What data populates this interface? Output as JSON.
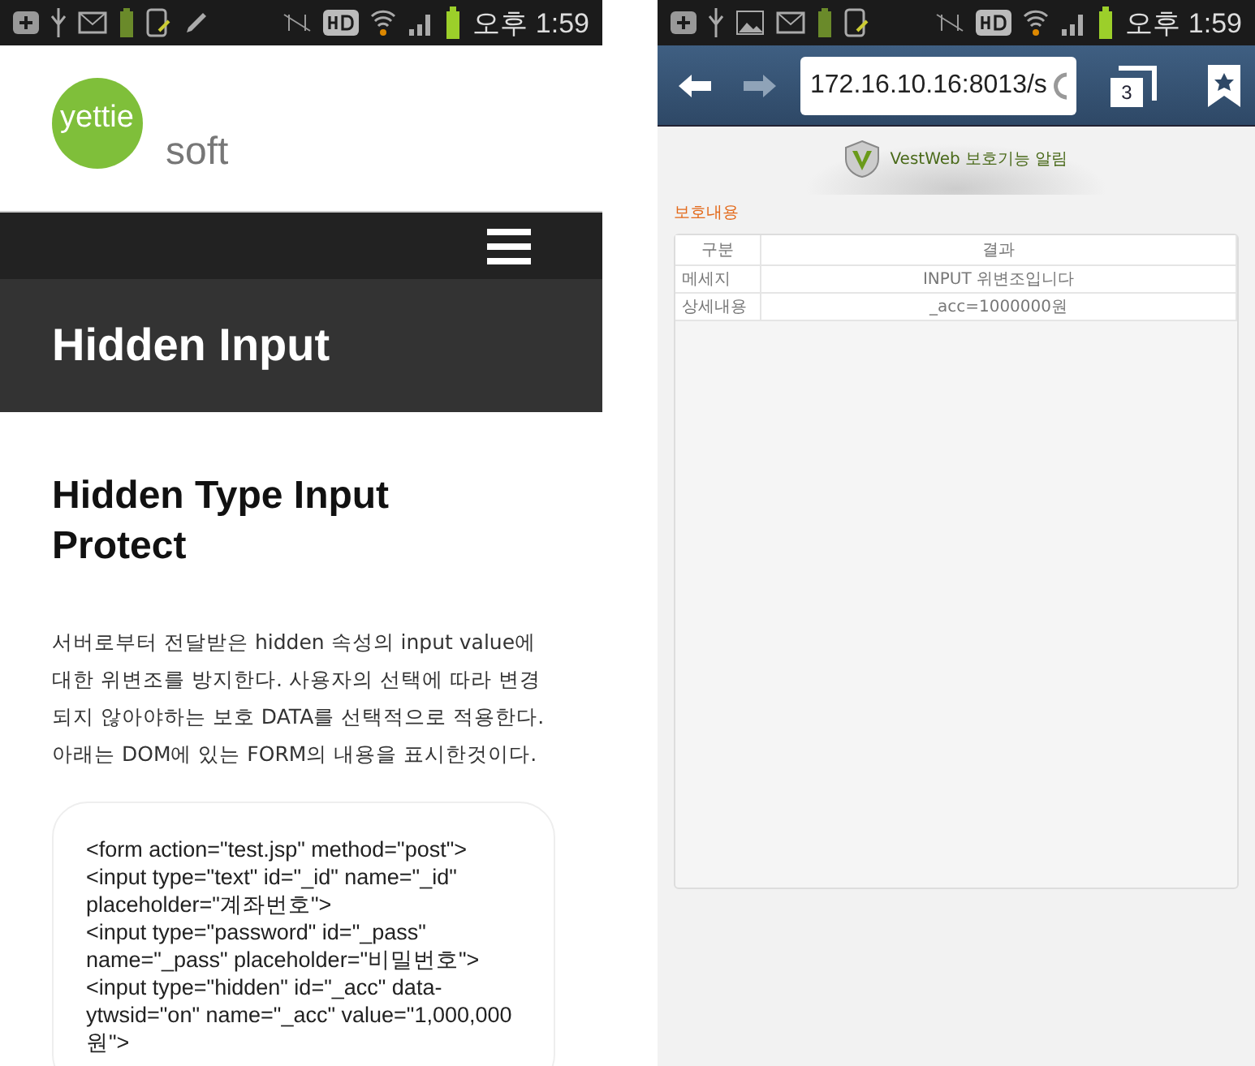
{
  "left_phone": {
    "status_bar": {
      "time": "오후 1:59"
    },
    "logo": {
      "word": "yettie",
      "sub": "soft"
    },
    "page_title": "Hidden Input",
    "heading": "Hidden Type Input Protect",
    "paragraph": "서버로부터 전달받은 hidden 속성의 input value에 대한 위변조를 방지한다. 사용자의 선택에 따라 변경되지 않아야하는 보호 DATA를 선택적으로 적용한다. 아래는 DOM에 있는 FORM의 내용을 표시한것이다.",
    "code_lines": [
      "<form action=\"test.jsp\" method=\"post\">",
      "<input type=\"text\" id=\"_id\" name=\"_id\" placeholder=\"계좌번호\">",
      "<input type=\"password\" id=\"_pass\" name=\"_pass\" placeholder=\"비밀번호\">",
      "<input type=\"hidden\" id=\"_acc\" data-ytwsid=\"on\" name=\"_acc\" value=\"1,000,000원\">"
    ]
  },
  "right_phone": {
    "status_bar": {
      "time": "오후 1:59"
    },
    "browser": {
      "url": "172.16.10.16:8013/s",
      "tab_count": "3"
    },
    "banner": "VestWeb 보호기능 알림",
    "section_label": "보호내용",
    "table": {
      "columns": [
        "구분",
        "결과"
      ],
      "rows": [
        [
          "메세지",
          "INPUT 위변조입니다"
        ],
        [
          "상세내용",
          "_acc=1000000원"
        ]
      ]
    }
  }
}
